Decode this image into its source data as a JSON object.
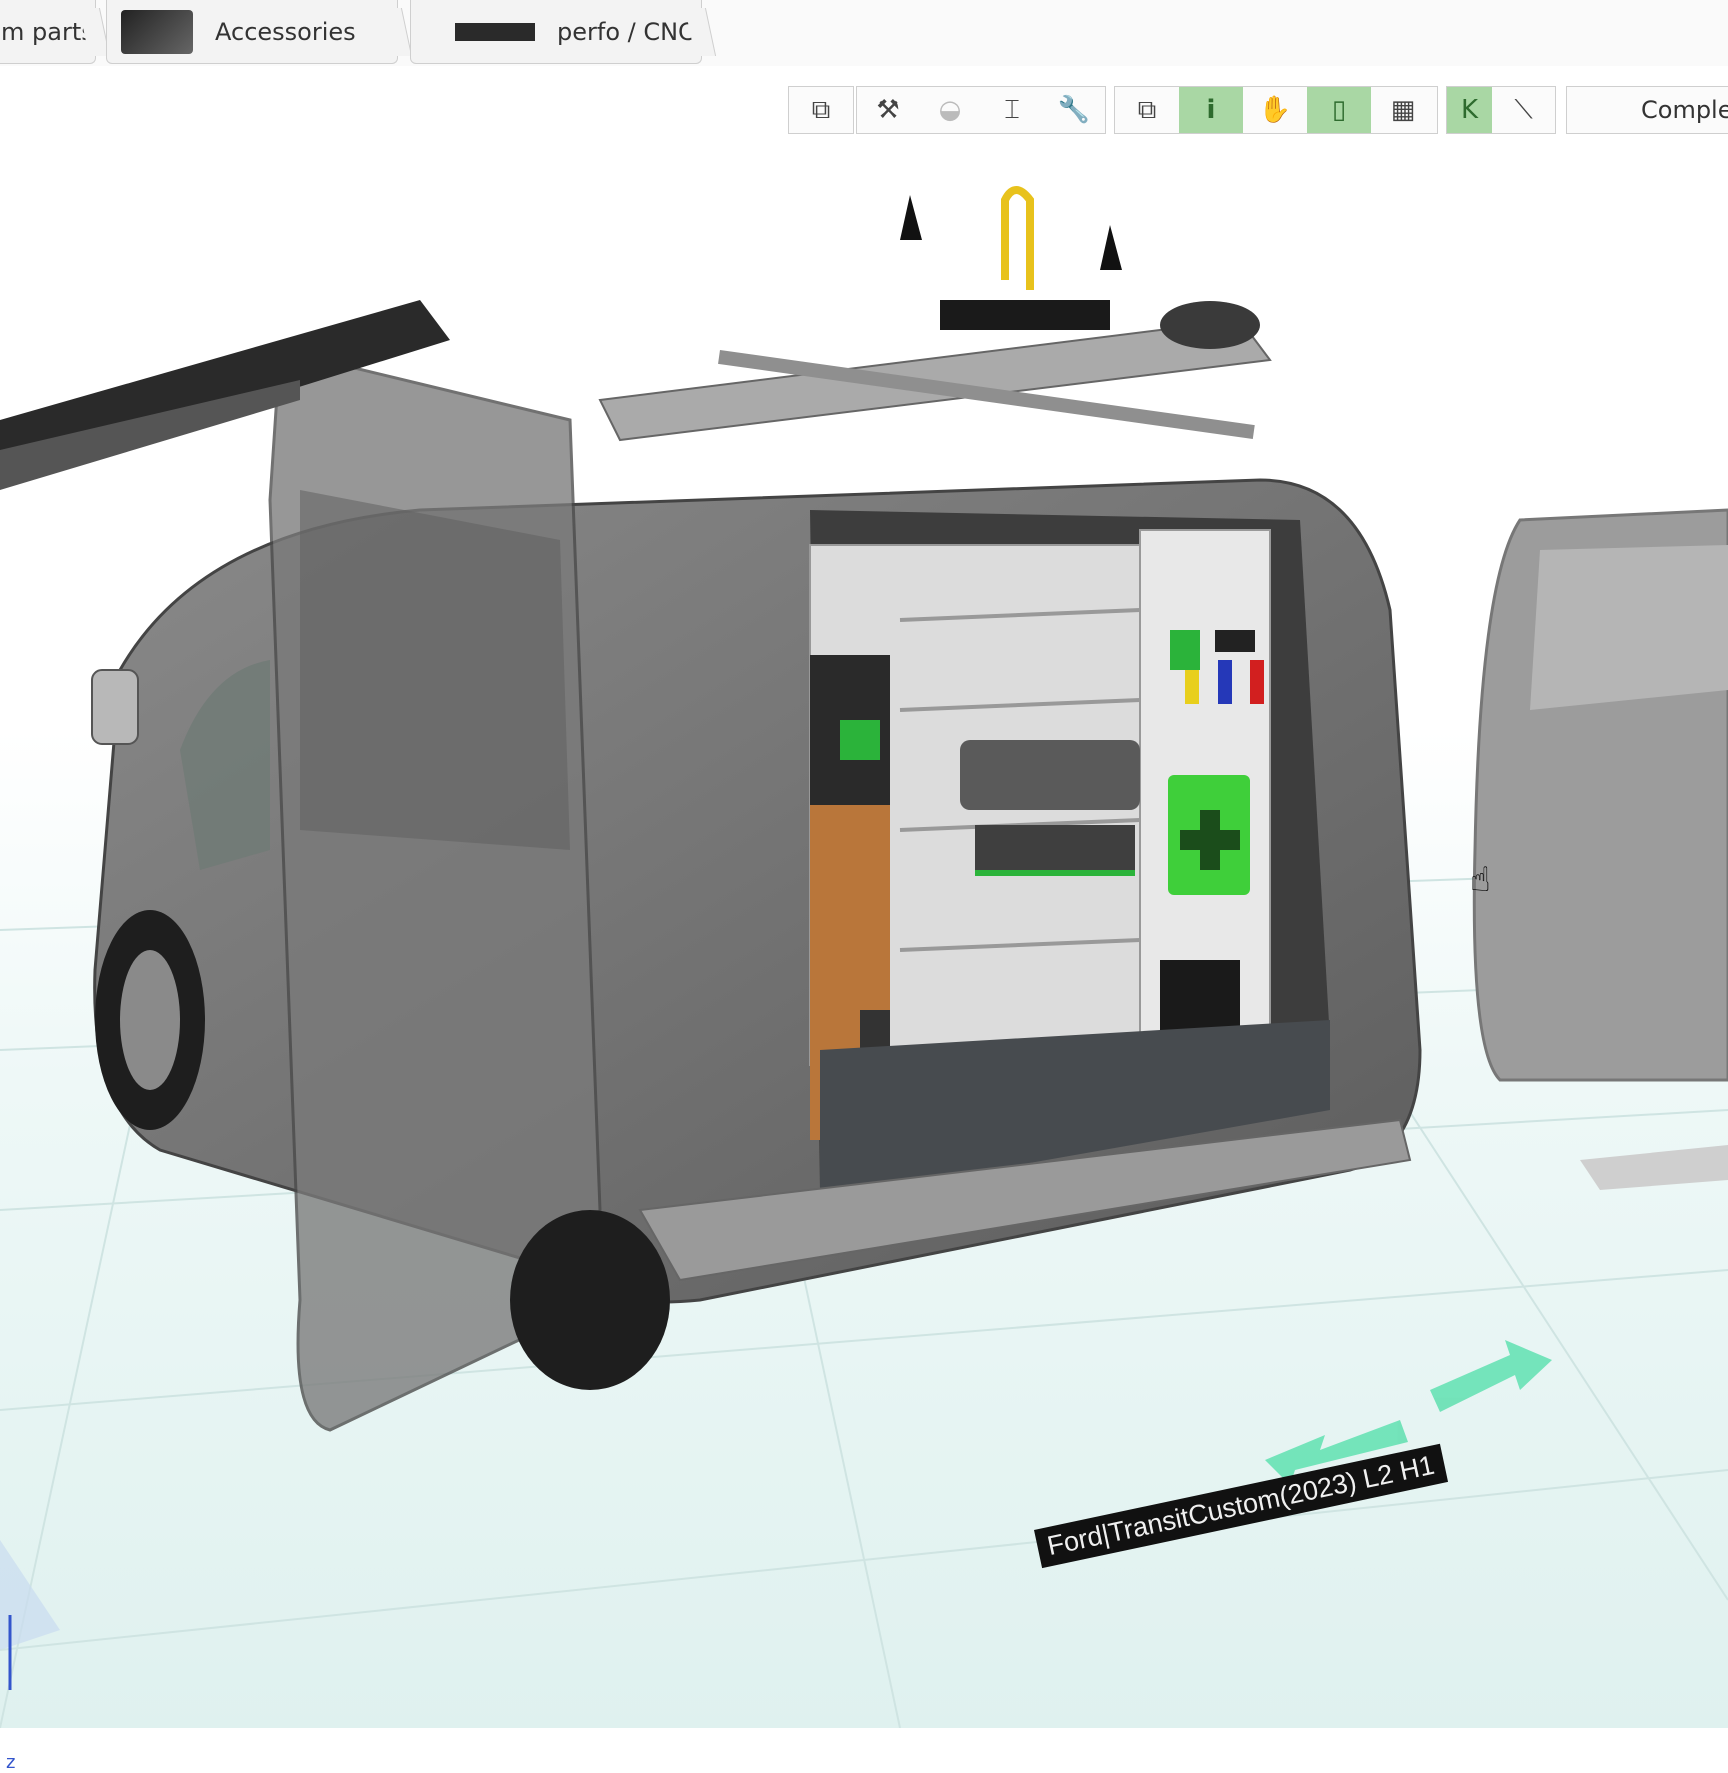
{
  "tabs": [
    {
      "label": "m parts"
    },
    {
      "label": "Accessories"
    },
    {
      "label": "perfo / CNC"
    }
  ],
  "toolbar": {
    "groups": [
      {
        "buttons": [
          {
            "icon": "copy-icon",
            "glyph": "⧉",
            "active": false
          }
        ]
      },
      {
        "buttons": [
          {
            "icon": "tools-icon",
            "glyph": "⚒",
            "active": false
          },
          {
            "icon": "helmet-icon",
            "glyph": "◒",
            "active": false,
            "dim": true
          },
          {
            "icon": "ladder-icon",
            "glyph": "⌶",
            "active": false
          },
          {
            "icon": "wrench-icon",
            "glyph": "🔧",
            "active": false
          }
        ]
      },
      {
        "buttons": [
          {
            "icon": "layers-icon",
            "glyph": "⧉",
            "active": false
          },
          {
            "icon": "info-icon",
            "glyph": "i",
            "active": true
          },
          {
            "icon": "hand-icon",
            "glyph": "✋",
            "active": false
          },
          {
            "icon": "extinguisher-icon",
            "glyph": "▯",
            "active": true
          },
          {
            "icon": "grid-panel-icon",
            "glyph": "▦",
            "active": false
          }
        ]
      },
      {
        "buttons": [
          {
            "icon": "k-icon",
            "glyph": "K",
            "active": true
          },
          {
            "icon": "measure-icon",
            "glyph": "⟍",
            "active": false
          }
        ]
      }
    ],
    "view_mode": "Comple"
  },
  "viewport": {
    "vehicle_label": "Ford|TransitCustom(2023) L2 H1",
    "axis_label": "z",
    "accent_color": "#5fe0b0"
  }
}
